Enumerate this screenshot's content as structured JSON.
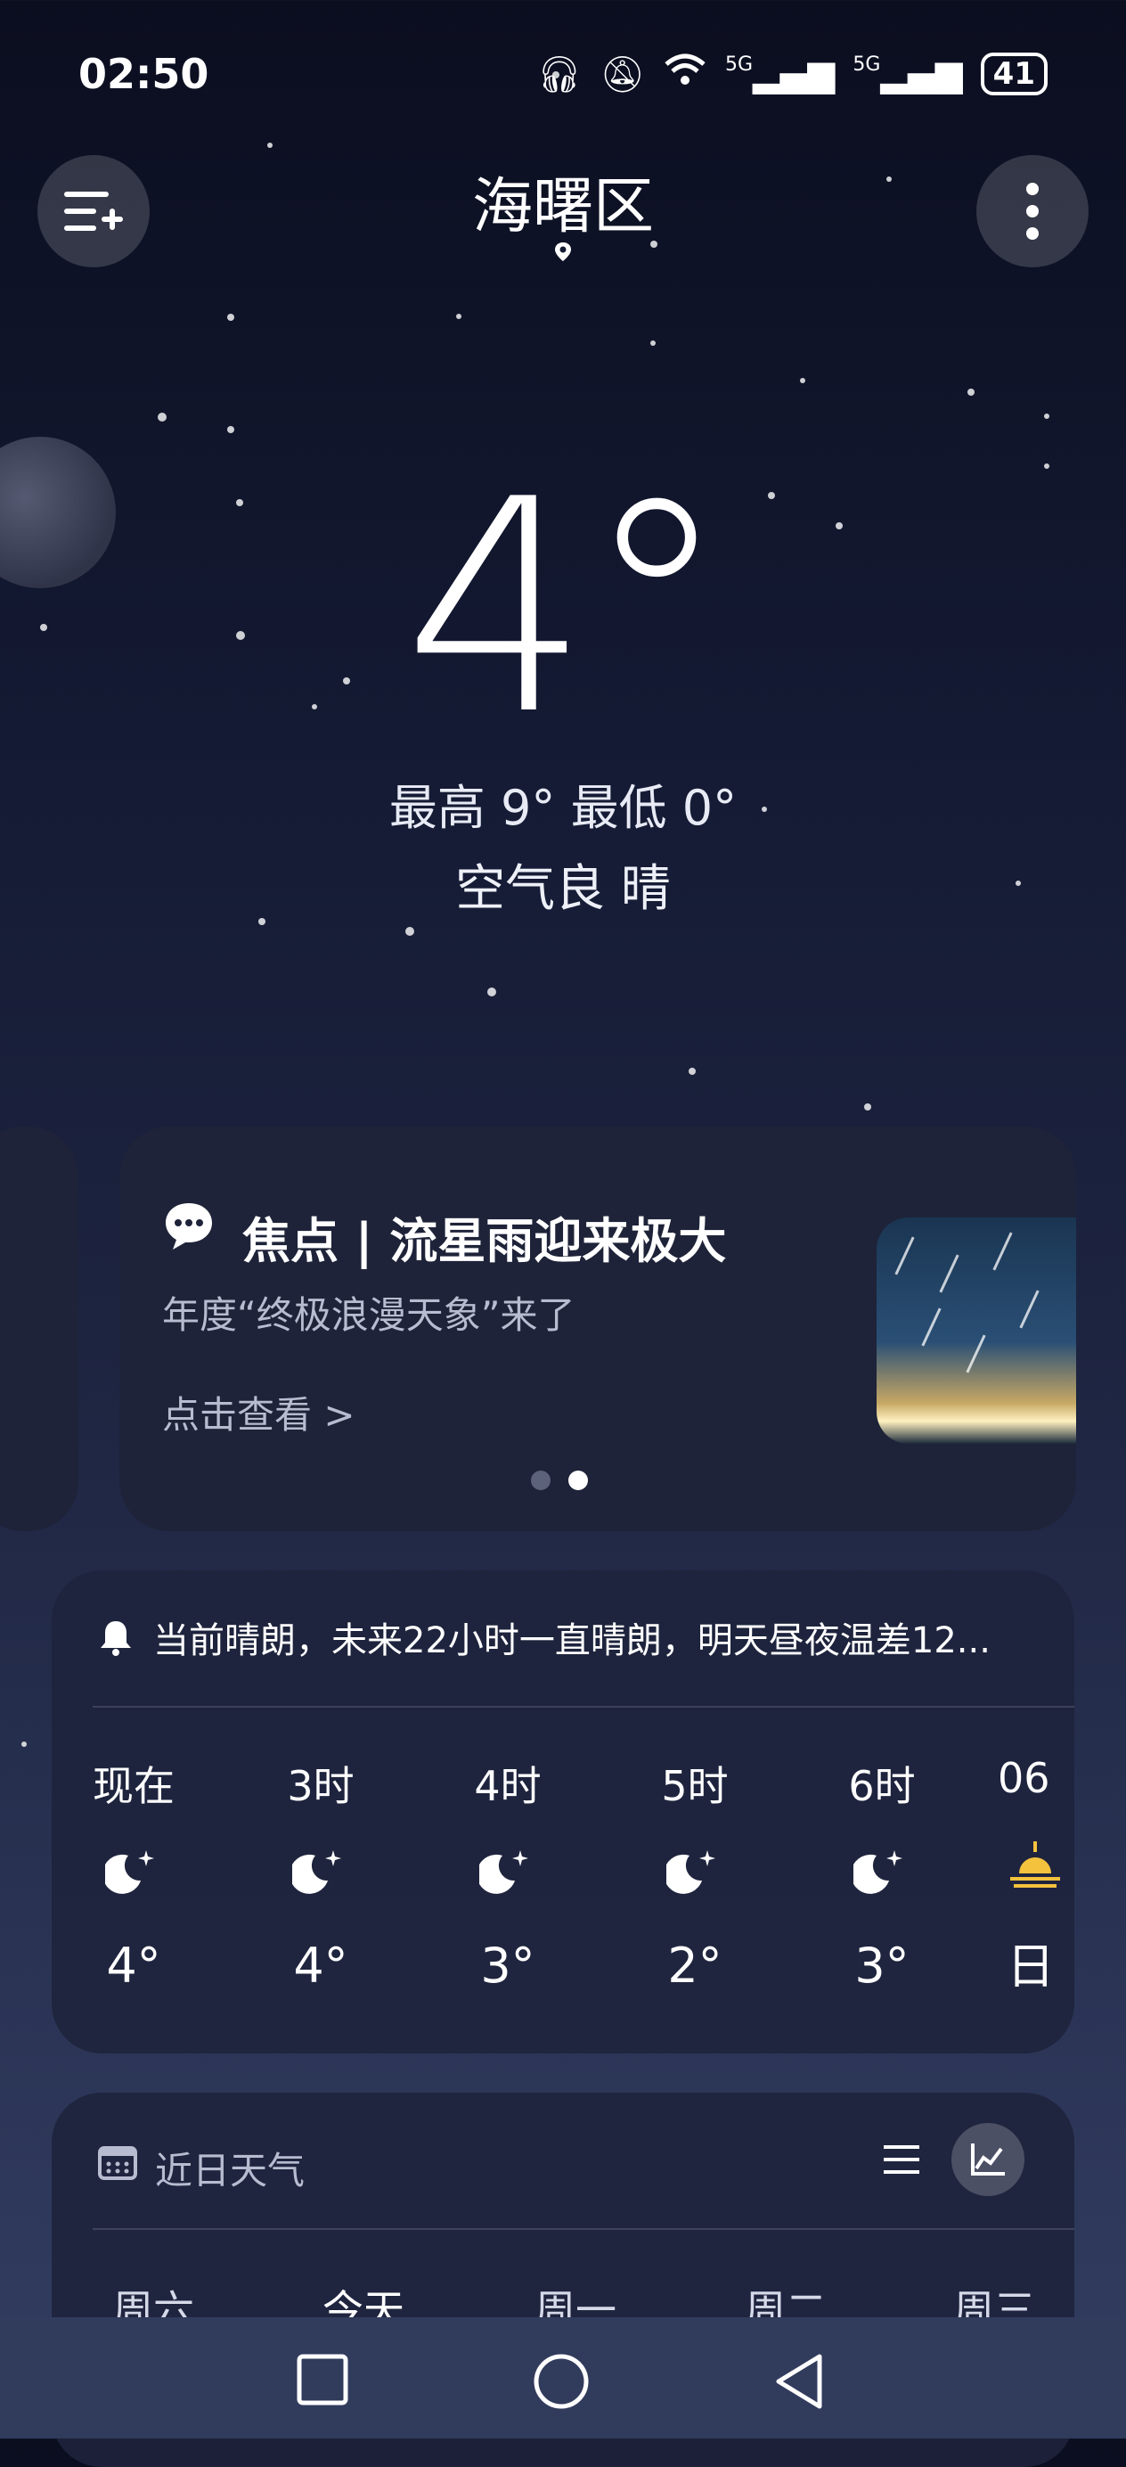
{
  "status_bar": {
    "time": "02:50",
    "network_1": "5G",
    "network_2": "5G",
    "battery": "41"
  },
  "header": {
    "location": "海曙区",
    "add_city_icon": "menu-add-icon",
    "more_icon": "more-vertical-icon"
  },
  "current": {
    "temperature": "4°",
    "range": "最高 9° 最低 0°",
    "air_and_weather": "空气良  晴"
  },
  "focus_card": {
    "title": "焦点 | 流星雨迎来极大",
    "subtitle": "年度“终极浪漫天象”来了",
    "link": "点击查看 >",
    "page_count": 2,
    "active_page": 2
  },
  "hourly": {
    "alert": "当前晴朗，未来22小时一直晴朗，明天昼夜温差12...",
    "hours": [
      {
        "label": "现在",
        "icon": "moon-stars-icon",
        "temp": "4°"
      },
      {
        "label": "3时",
        "icon": "moon-stars-icon",
        "temp": "4°"
      },
      {
        "label": "4时",
        "icon": "moon-stars-icon",
        "temp": "3°"
      },
      {
        "label": "5时",
        "icon": "moon-stars-icon",
        "temp": "2°"
      },
      {
        "label": "6时",
        "icon": "moon-stars-icon",
        "temp": "3°"
      },
      {
        "label": "06",
        "icon": "sunrise-icon",
        "temp": "日"
      }
    ]
  },
  "recent": {
    "title": "近日天气",
    "days": [
      "周六",
      "今天",
      "周一",
      "周二",
      "周三"
    ]
  },
  "colors": {
    "accent_sun": "#f4c23d",
    "card_bg": "#1e2339"
  }
}
